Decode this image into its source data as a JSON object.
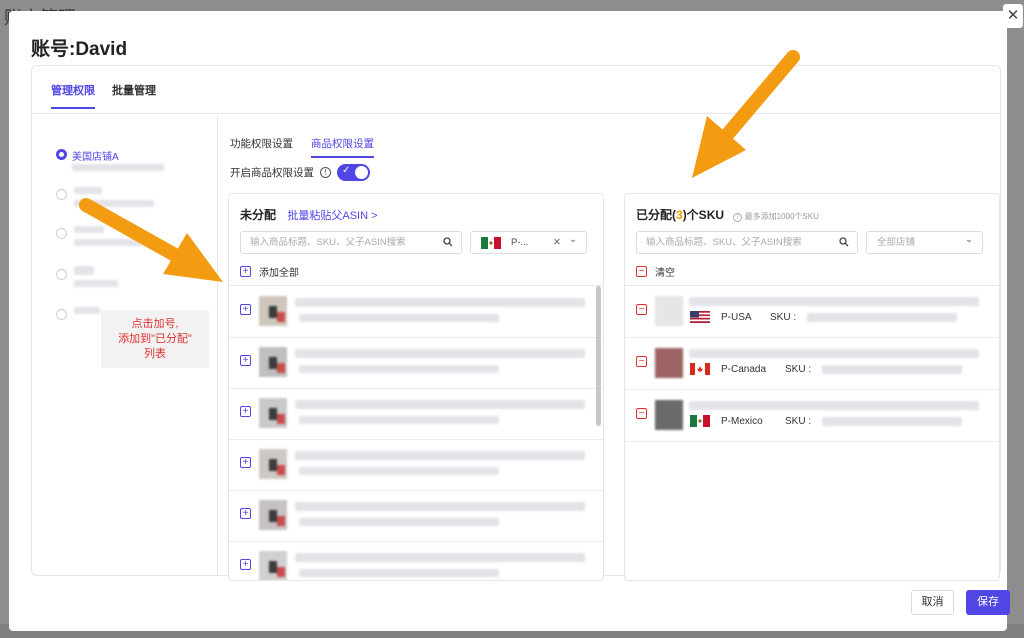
{
  "background": {
    "title": "账户管理"
  },
  "modal": {
    "title": "账号:David",
    "close_glyph": "✕"
  },
  "main_tabs": [
    {
      "label": "管理权限",
      "active": true
    },
    {
      "label": "批量管理",
      "active": false
    }
  ],
  "stores": [
    {
      "label": "美国店铺A",
      "selected": true
    }
  ],
  "tooltip": {
    "lines": [
      "点击加号,",
      "添加到\"已分配\"",
      "列表"
    ]
  },
  "sub_tabs": [
    {
      "label": "功能权限设置",
      "active": false
    },
    {
      "label": "商品权限设置",
      "active": true
    }
  ],
  "permission_toggle": {
    "label": "开启商品权限设置",
    "on": true,
    "check": "✓",
    "info": "!"
  },
  "unassigned": {
    "title": "未分配",
    "batch_link": "批量粘贴父ASIN >",
    "search_placeholder": "输入商品标题、SKU、父子ASIN搜索",
    "store_select": "P-...",
    "store_clear": "✕",
    "store_chevron": "⌄",
    "add_all": "添加全部",
    "add_glyph": "+",
    "row_count": 6
  },
  "assigned": {
    "title_prefix": "已分配(",
    "count": "3",
    "title_suffix": ")个SKU",
    "limit_note": "最多添加1000个SKU",
    "search_placeholder": "输入商品标题、SKU、父子ASIN搜索",
    "store_select": "全部店铺",
    "store_chevron": "⌄",
    "clear_all": "清空",
    "remove_glyph": "−",
    "items": [
      {
        "store": "P-USA",
        "sku_label": "SKU :"
      },
      {
        "store": "P-Canada",
        "sku_label": "SKU :"
      },
      {
        "store": "P-Mexico",
        "sku_label": "SKU :"
      }
    ]
  },
  "footer": {
    "cancel": "取消",
    "save": "保存"
  },
  "colors": {
    "accent": "#5046e5",
    "arrow": "#f39c12",
    "warning": "#e03131",
    "count": "#f0a000"
  }
}
